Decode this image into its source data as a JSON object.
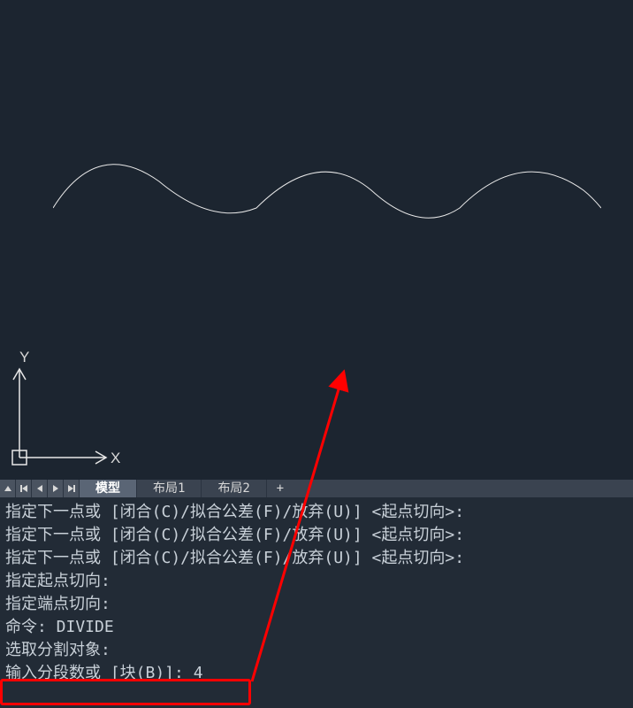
{
  "ucs": {
    "x_label": "X",
    "y_label": "Y"
  },
  "tabs": {
    "model": "模型",
    "layout1": "布局1",
    "layout2": "布局2",
    "add": "+"
  },
  "command_lines": [
    "指定下一点或 [闭合(C)/拟合公差(F)/放弃(U)] <起点切向>:",
    "指定下一点或 [闭合(C)/拟合公差(F)/放弃(U)] <起点切向>:",
    "指定下一点或 [闭合(C)/拟合公差(F)/放弃(U)] <起点切向>:",
    "指定起点切向:",
    "指定端点切向:",
    "命令: DIVIDE",
    "选取分割对象:",
    "输入分段数或 [块(B)]: 4"
  ]
}
